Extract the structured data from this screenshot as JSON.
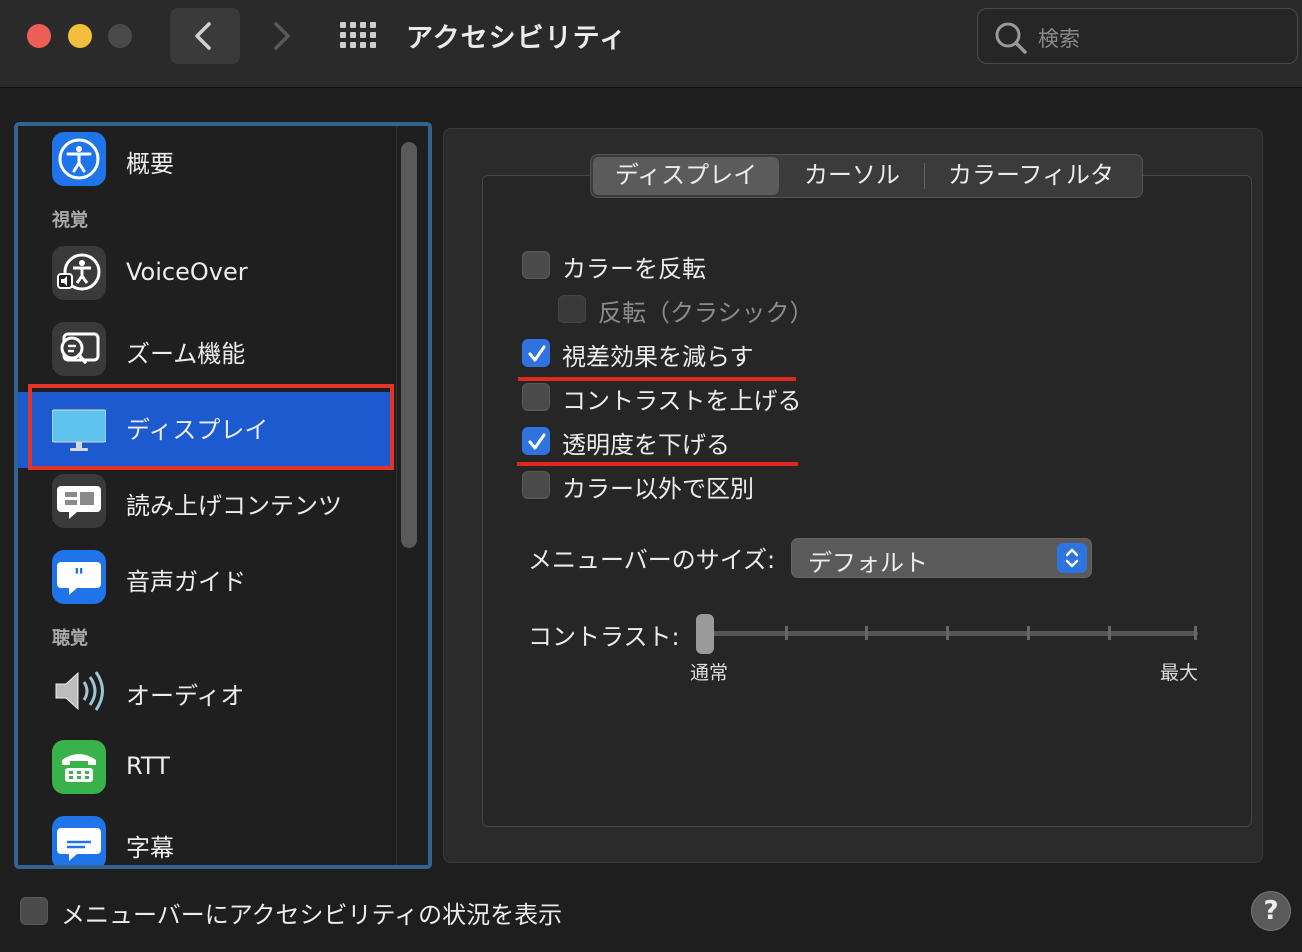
{
  "window": {
    "title": "アクセシビリティ",
    "search_placeholder": "検索"
  },
  "toolbar": {
    "back_icon": "chevron-left-icon",
    "forward_icon": "chevron-right-icon",
    "grid_icon": "show-all-grid-icon"
  },
  "sidebar": {
    "sections": [
      "視覚",
      "聴覚"
    ],
    "items": [
      {
        "label": "概要",
        "icon": "accessibility-icon"
      },
      {
        "label": "VoiceOver",
        "icon": "voiceover-icon"
      },
      {
        "label": "ズーム機能",
        "icon": "zoom-icon"
      },
      {
        "label": "ディスプレイ",
        "icon": "display-icon",
        "selected": true
      },
      {
        "label": "読み上げコンテンツ",
        "icon": "spoken-content-icon"
      },
      {
        "label": "音声ガイド",
        "icon": "descriptions-icon"
      },
      {
        "label": "オーディオ",
        "icon": "speaker-icon"
      },
      {
        "label": "RTT",
        "icon": "rtt-phone-icon"
      },
      {
        "label": "字幕",
        "icon": "captions-icon"
      }
    ]
  },
  "tabs": [
    {
      "label": "ディスプレイ",
      "selected": true
    },
    {
      "label": "カーソル",
      "selected": false
    },
    {
      "label": "カラーフィルタ",
      "selected": false
    }
  ],
  "options": [
    {
      "label": "カラーを反転",
      "checked": false,
      "enabled": true
    },
    {
      "label": "反転（クラシック）",
      "checked": false,
      "enabled": false
    },
    {
      "label": "視差効果を減らす",
      "checked": true,
      "enabled": true
    },
    {
      "label": "コントラストを上げる",
      "checked": false,
      "enabled": true
    },
    {
      "label": "透明度を下げる",
      "checked": true,
      "enabled": true
    },
    {
      "label": "カラー以外で区別",
      "checked": false,
      "enabled": true
    }
  ],
  "menubar_size": {
    "label": "メニューバーのサイズ:",
    "value": "デフォルト"
  },
  "contrast": {
    "label": "コントラスト:",
    "min_label": "通常",
    "max_label": "最大",
    "value_fraction": 0.0
  },
  "footer": {
    "status_label": "メニューバーにアクセシビリティの状況を表示",
    "status_checked": false,
    "help_label": "?"
  },
  "colors": {
    "accent": "#2f73e0",
    "selection": "#1c5bcf",
    "annotation_red": "#e0281f"
  }
}
